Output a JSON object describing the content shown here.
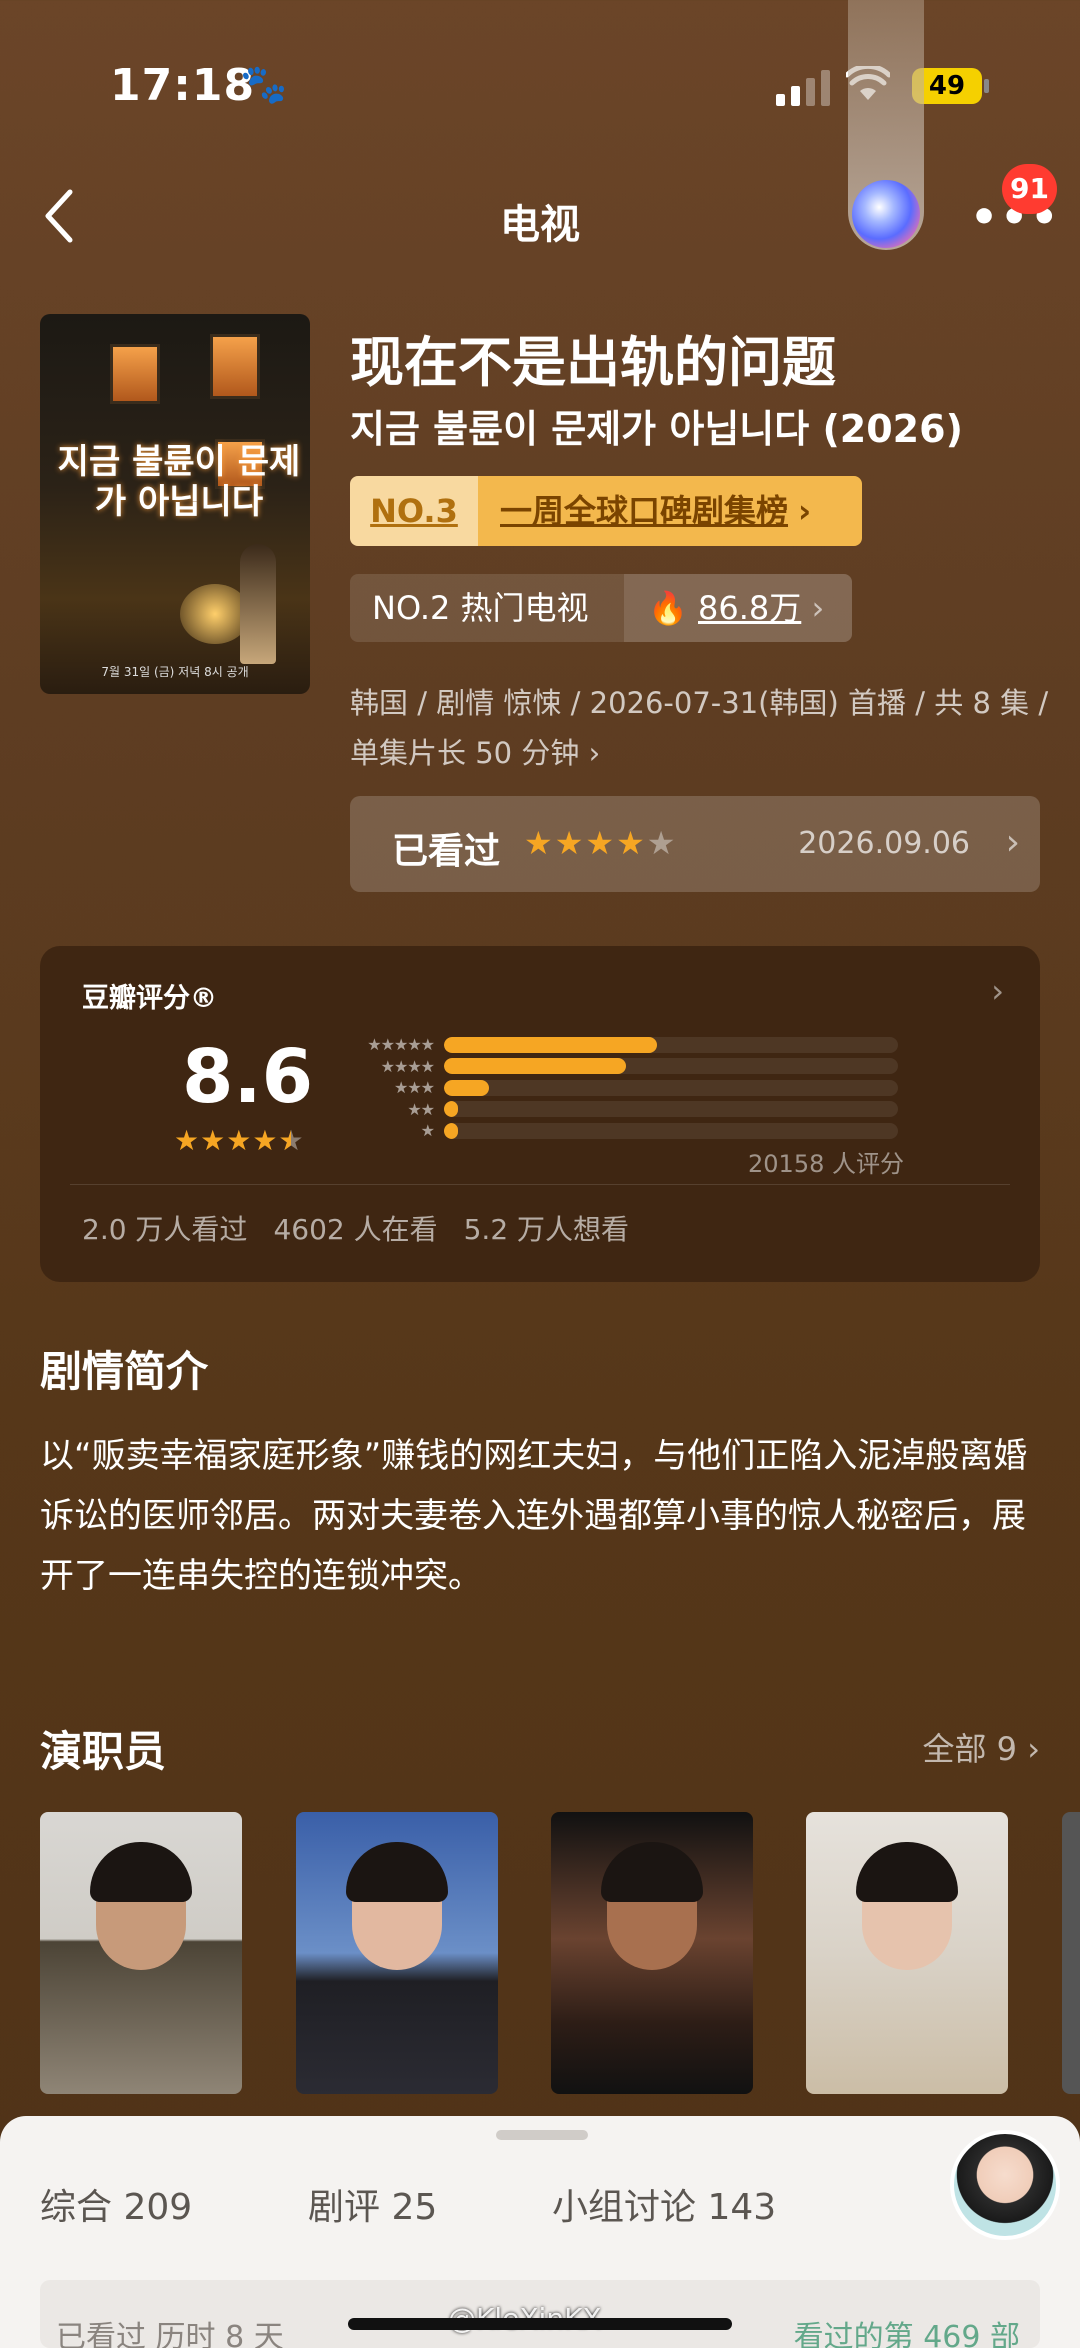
{
  "status_bar": {
    "time": "17:18",
    "battery": "49"
  },
  "nav": {
    "title": "电视",
    "notification_count": "91"
  },
  "show": {
    "title_cn": "现在不是出轨的问题",
    "title_kr": "지금 불륜이 문제가 아닙니다 (2026)",
    "poster_title": "지금 불륜이 문제가 아닙니다",
    "poster_foot": "7월 31일 (금) 저녁 8시 공개",
    "rank_no": "NO.3",
    "rank_list": "一周全球口碑剧集榜",
    "hot_label": "NO.2 热门电视",
    "hot_value": "86.8万",
    "meta_line1": "韩国 / 剧情 惊悚 / 2026-07-31(韩国) 首播 / 共 8 集 /",
    "meta_line2": "单集片长 50 分钟"
  },
  "watched": {
    "label": "已看过",
    "stars": 4,
    "date": "2026.09.06"
  },
  "rating": {
    "label": "豆瓣评分®",
    "score": "8.6",
    "stars": 4.5,
    "count_text": "20158 人评分",
    "distribution": [
      {
        "stars": "★★★★★",
        "fraction": 0.47
      },
      {
        "stars": "★★★★",
        "fraction": 0.4
      },
      {
        "stars": "★★★",
        "fraction": 0.1
      },
      {
        "stars": "★★",
        "fraction": 0.03
      },
      {
        "stars": "★",
        "fraction": 0.03
      }
    ],
    "watched": "2.0 万人看过",
    "watching": "4602 人在看",
    "want": "5.2 万人想看"
  },
  "synopsis": {
    "heading": "剧情简介",
    "text": "以“贩卖幸福家庭形象”赚钱的网红夫妇，与他们正陷入泥淖般离婚诉讼的医师邻居。两对夫妻卷入连外遇都算小事的惊人秘密后，展开了一连串失控的连锁冲突。"
  },
  "cast": {
    "heading": "演职员",
    "all_label": "全部 9"
  },
  "bottom_tabs": [
    {
      "label": "综合 209"
    },
    {
      "label": "剧评 25"
    },
    {
      "label": "小组讨论 143"
    }
  ],
  "bottom_band": {
    "left": "已看过 历时 8 天",
    "right": "看过的第 469 部"
  },
  "watermark": "@KleXinKX",
  "colors": {
    "accent": "#f6a623",
    "badge": "#ff3b30",
    "rank_bg": "#f3b84d"
  },
  "icons": [
    "paw-icon",
    "signal-icon",
    "wifi-icon",
    "back-chevron-icon",
    "more-icon",
    "fire-icon",
    "chevron-right-icon",
    "star-icon"
  ]
}
